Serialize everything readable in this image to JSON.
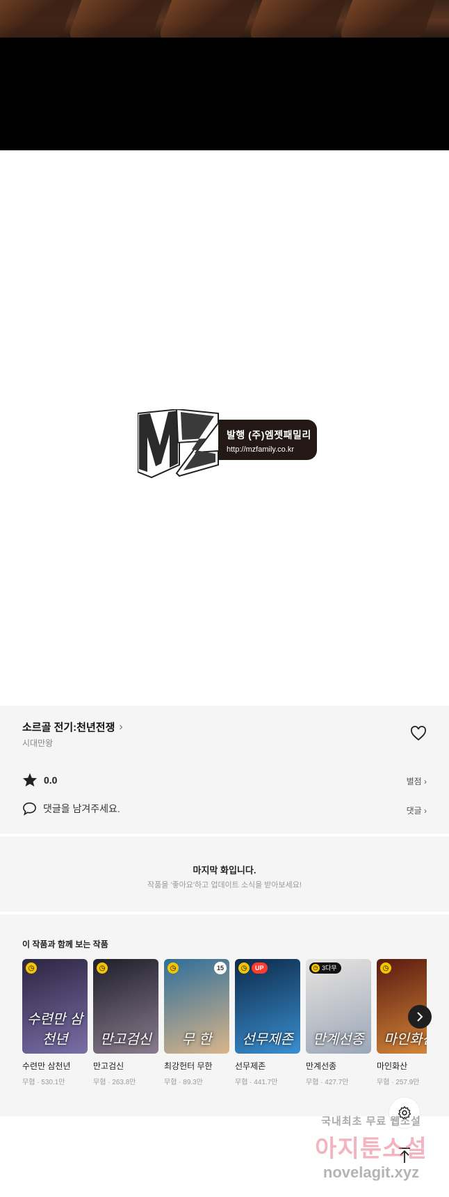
{
  "logo": {
    "publisher_line": "발행 (주)엠젯패밀리",
    "url_line": "http://mzfamily.co.kr"
  },
  "episode": {
    "title": "소르골 전기:천년전쟁",
    "author": "시대만왕",
    "rating": "0.0",
    "rate_link": "별점",
    "comment_placeholder": "댓글을 남겨주세요.",
    "comment_link": "댓글"
  },
  "last_notice": {
    "title": "마지막 화입니다.",
    "subtitle": "작품을 '좋아요'하고 업데이트 소식을 받아보세요!"
  },
  "recommend": {
    "title": "이 작품과 함께 보는 작품",
    "items": [
      {
        "title": "수련만 삼천년",
        "meta": "무협 · 530.1만",
        "cover": "수련만 삼천년",
        "badge": "clock",
        "colors": [
          "#2b2540",
          "#7a6fa8"
        ]
      },
      {
        "title": "만고검신",
        "meta": "무협 · 263.8만",
        "cover": "만고검신",
        "badge": "clock",
        "colors": [
          "#1e1e2a",
          "#8a7c8e"
        ]
      },
      {
        "title": "최강헌터 무한",
        "meta": "무협 · 89.3만",
        "cover": "무  한",
        "badge": "clock",
        "age": "15",
        "colors": [
          "#2e6e9a",
          "#d9b58a"
        ]
      },
      {
        "title": "선무제존",
        "meta": "무협 · 441.7만",
        "cover": "선무제존",
        "badge": "up",
        "up_label": "UP",
        "colors": [
          "#0d2a4a",
          "#3a8fd0"
        ]
      },
      {
        "title": "만계선종",
        "meta": "무협 · 427.7만",
        "cover": "만계선종",
        "badge": "wait",
        "wait_label": "3다무",
        "colors": [
          "#e8e4e0",
          "#9aa6b8"
        ]
      },
      {
        "title": "마인화산",
        "meta": "무협 · 257.9만",
        "cover": "마인화산",
        "badge": "clock",
        "colors": [
          "#5a1a10",
          "#d88a3a"
        ]
      }
    ]
  },
  "watermark": {
    "line1": "국내최초 무료 웹소설",
    "line2": "아지툰소설",
    "line3": "novelagit.xyz"
  }
}
